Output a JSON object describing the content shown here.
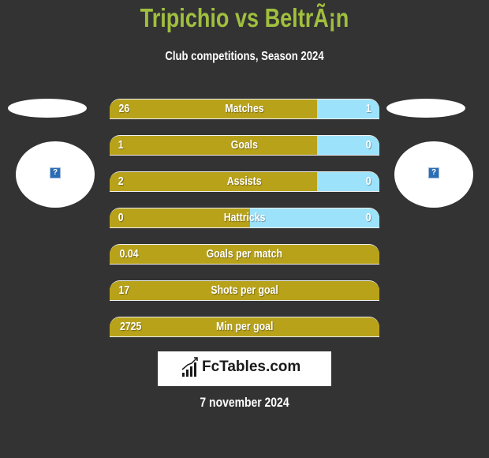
{
  "header": {
    "title": "Tripichio vs BeltrÃ¡n",
    "subtitle": "Club competitions, Season 2024"
  },
  "players": {
    "left": {
      "logo_icon": "missing-image-icon",
      "logo_glyph": "?"
    },
    "right": {
      "logo_icon": "missing-image-icon",
      "logo_glyph": "?"
    }
  },
  "colors": {
    "left_bar": "#b8a21a",
    "right_bar": "#9de2fb",
    "title": "#a0bf3e",
    "background": "#333333"
  },
  "stats": [
    {
      "label": "Matches",
      "left": "26",
      "right": "1",
      "left_share": 0.77
    },
    {
      "label": "Goals",
      "left": "1",
      "right": "0",
      "left_share": 0.77
    },
    {
      "label": "Assists",
      "left": "2",
      "right": "0",
      "left_share": 0.77
    },
    {
      "label": "Hattricks",
      "left": "0",
      "right": "0",
      "left_share": 0.52
    },
    {
      "label": "Goals per match",
      "left": "0.04",
      "right": "",
      "left_share": 1.0
    },
    {
      "label": "Shots per goal",
      "left": "17",
      "right": "",
      "left_share": 1.0
    },
    {
      "label": "Min per goal",
      "left": "2725",
      "right": "",
      "left_share": 1.0
    }
  ],
  "brand": {
    "name": "FcTables.com",
    "icon": "bar-chart-icon"
  },
  "footer": {
    "date": "7 november 2024"
  }
}
